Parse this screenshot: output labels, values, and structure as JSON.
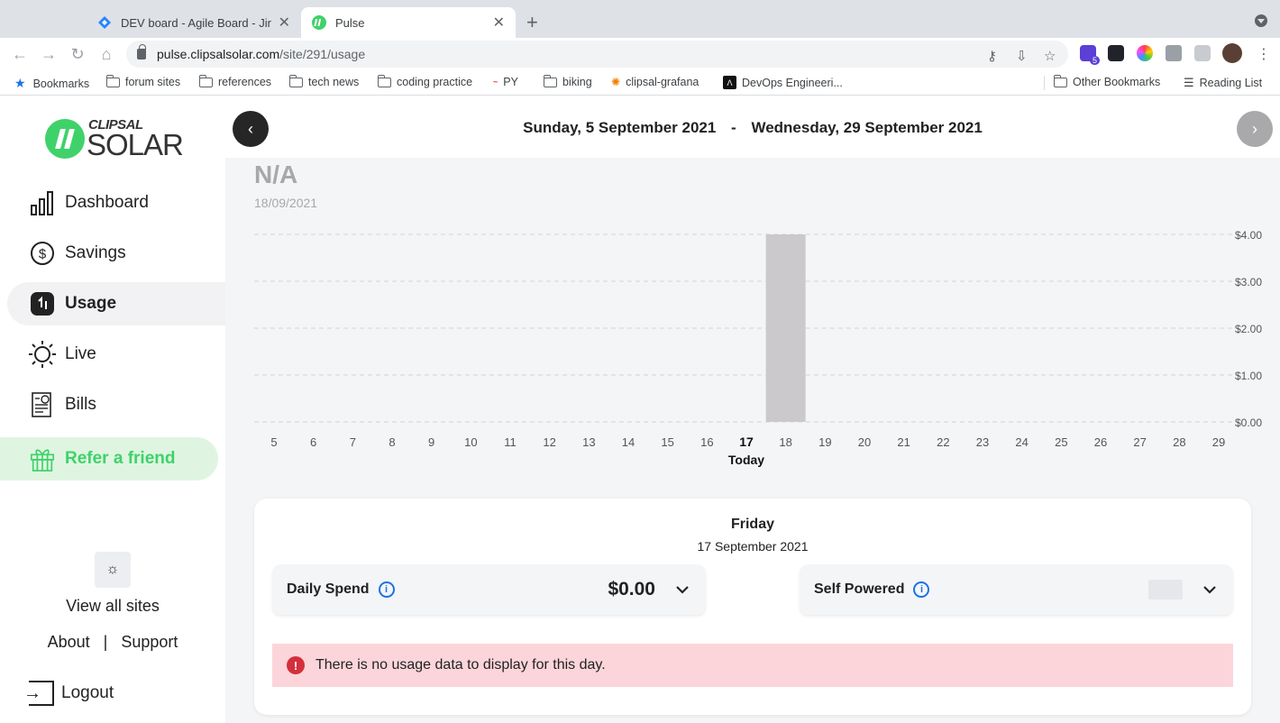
{
  "browser": {
    "tabs": [
      {
        "title": "DEV board - Agile Board - Jira",
        "active": false
      },
      {
        "title": "Pulse",
        "active": true
      }
    ],
    "url_host": "pulse.clipsalsolar.com",
    "url_path": "/site/291/usage",
    "bookmarks": [
      {
        "label": "Bookmarks"
      },
      {
        "label": "forum sites"
      },
      {
        "label": "references"
      },
      {
        "label": "tech news"
      },
      {
        "label": "coding practice"
      },
      {
        "label": "PY"
      },
      {
        "label": "biking"
      },
      {
        "label": "clipsal-grafana"
      },
      {
        "label": "DevOps Engineeri..."
      },
      {
        "label": "Other Bookmarks"
      },
      {
        "label": "Reading List"
      }
    ],
    "extension_badge": "5"
  },
  "logo": {
    "top": "CLIPSAL",
    "bottom": "SOLAR"
  },
  "sidebar": {
    "items": [
      {
        "label": "Dashboard"
      },
      {
        "label": "Savings"
      },
      {
        "label": "Usage"
      },
      {
        "label": "Live"
      },
      {
        "label": "Bills"
      },
      {
        "label": "Refer a friend"
      }
    ],
    "view_all_sites": "View all sites",
    "about": "About",
    "separator": "|",
    "support": "Support",
    "logout": "Logout"
  },
  "header": {
    "start_date": "Sunday, 5 September 2021",
    "dash": "-",
    "end_date": "Wednesday, 29 September 2021"
  },
  "selected": {
    "value": "N/A",
    "date": "18/09/2021"
  },
  "chart_data": {
    "type": "bar",
    "categories": [
      "5",
      "6",
      "7",
      "8",
      "9",
      "10",
      "11",
      "12",
      "13",
      "14",
      "15",
      "16",
      "17",
      "18",
      "19",
      "20",
      "21",
      "22",
      "23",
      "24",
      "25",
      "26",
      "27",
      "28",
      "29"
    ],
    "values": [
      null,
      null,
      null,
      null,
      null,
      null,
      null,
      null,
      null,
      null,
      null,
      null,
      null,
      4.0,
      null,
      null,
      null,
      null,
      null,
      null,
      null,
      null,
      null,
      null,
      null
    ],
    "highlight_category": "17",
    "highlight_sublabel": "Today",
    "y_ticks": [
      "$0.00",
      "$1.00",
      "$2.00",
      "$3.00",
      "$4.00"
    ],
    "ylim": [
      0,
      4
    ],
    "bar_color": "#cbc9cc",
    "gridlines": "dashed"
  },
  "day_card": {
    "day": "Friday",
    "date": "17 September 2021",
    "daily_spend_label": "Daily Spend",
    "daily_spend_value": "$0.00",
    "self_powered_label": "Self Powered",
    "alert": "There is no usage data to display for this day."
  },
  "colors": {
    "brand_green": "#3fd26a",
    "alert_bg": "#fbd5da",
    "alert_icon": "#d32f3c",
    "info_blue": "#1a73e8"
  }
}
